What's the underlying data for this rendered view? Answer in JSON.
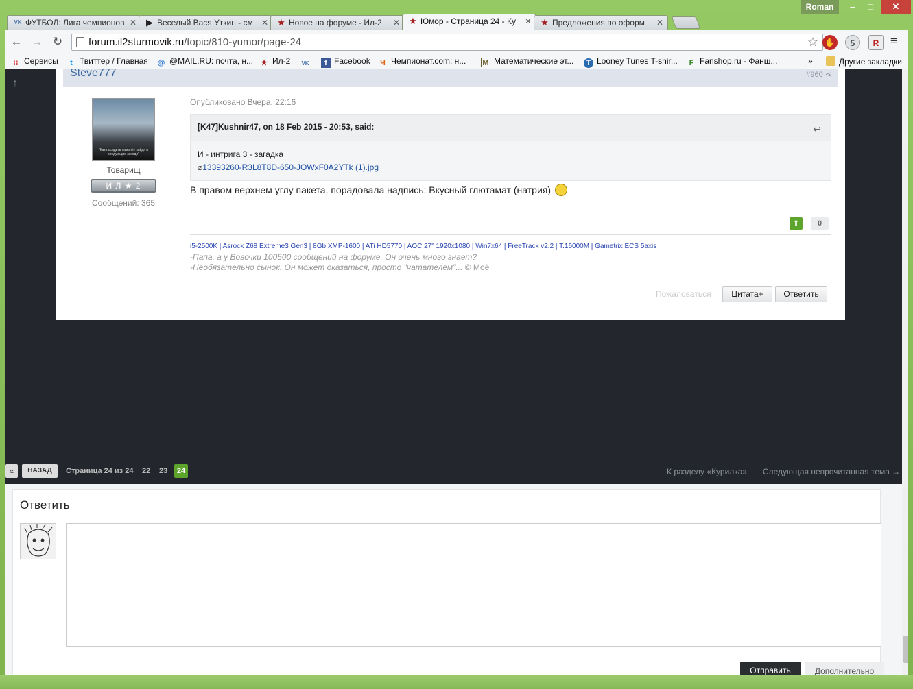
{
  "window": {
    "user": "Roman",
    "min": "–",
    "max": "□",
    "close": "✕"
  },
  "tabs": [
    {
      "title": "ФУТБОЛ: Лига чемпионов",
      "icon": "vk-icon",
      "glyph": "VK",
      "color": "#4a76a8"
    },
    {
      "title": "Веселый Вася Уткин - см",
      "icon": "play-icon",
      "glyph": "▶",
      "color": "#222222"
    },
    {
      "title": "Новое на форуме - Ил-2",
      "icon": "star-icon",
      "glyph": "★",
      "color": "#a31f1f"
    },
    {
      "title": "Юмор - Страница 24 - Ку",
      "icon": "star-icon",
      "glyph": "★",
      "color": "#a31f1f",
      "active": true
    },
    {
      "title": "Предложения по оформ",
      "icon": "star-icon",
      "glyph": "★",
      "color": "#a31f1f"
    }
  ],
  "toolbar": {
    "back": "←",
    "forward": "→",
    "reload": "↻",
    "url_domain": "forum.il2sturmovik.ru",
    "url_path": "/topic/810-yumor/page-24",
    "star": "☆",
    "menu": "≡",
    "ext_badge": "5"
  },
  "bookmarks": [
    {
      "label": "Сервисы",
      "icon": "apps-grid-icon",
      "glyph": "⁞⁞",
      "color": "#d44"
    },
    {
      "label": "Твиттер / Главная",
      "icon": "twitter-icon",
      "glyph": "t",
      "color": "#1da1f2"
    },
    {
      "label": "@MAIL.RU: почта, н...",
      "icon": "mailru-icon",
      "glyph": "@",
      "color": "#1d6fd1"
    },
    {
      "label": "Ил-2",
      "icon": "star-icon",
      "glyph": "★",
      "color": "#a31f1f"
    },
    {
      "label": "",
      "icon": "vk-icon",
      "glyph": "VK",
      "color": "#4a76a8"
    },
    {
      "label": "Facebook",
      "icon": "facebook-icon",
      "glyph": "f",
      "color": "#3b5998"
    },
    {
      "label": "Чемпионат.com: н...",
      "icon": "championat-icon",
      "glyph": "Ч",
      "color": "#e0661b"
    },
    {
      "label": "Математические эт...",
      "icon": "math-icon",
      "glyph": "M",
      "color": "#6b5b2a"
    },
    {
      "label": "Looney Tunes T-shir...",
      "icon": "tshirt-icon",
      "glyph": "T",
      "color": "#2a6bb0"
    },
    {
      "label": "Fanshop.ru - Фанш...",
      "icon": "fanshop-icon",
      "glyph": "F",
      "color": "#3a8a2a"
    }
  ],
  "bookmarks_more": "»",
  "bookmarks_other": "Другие закладки",
  "post": {
    "author": "Steve777",
    "number": "#960",
    "avatar_caption": "\"Как посадить самолёт зайдя в следующие заходе\"",
    "rank": "Товарищ",
    "rank_badge": "И Л ★ 2",
    "post_count": "Сообщений: 365",
    "posted": "Опубликовано Вчера, 22:16",
    "quote_header": "[K47]Kushnir47, on 18 Feb 2015 - 20:53, said:",
    "quote_text": "И - интрига 3 - загадка",
    "quote_link": "13393260-R3L8T8D-650-JOWxF0A2YTk (1).jpg",
    "text": "В правом верхнем углу пакета, порадовала надпись: Вкусный глютамат (натрия)",
    "rep_value": "0",
    "signature_specs": "i5-2500K | Asrock Z68 Extreme3 Gen3 | 8Gb XMP-1600 | ATi HD5770 | AOC 27\" 1920x1080 | Win7x64 | FreeTrack v2.2 | T.16000M | Gametrix ECS 5axis",
    "signature_line1": "-Папа, а у Вовочки 100500 сообщений на форуме. Он очень много знает?",
    "signature_line2": "-Необязательно сынок. Он может оказаться, просто \"чатателем\"...",
    "signature_author": "© Моё",
    "report": "Пожаловаться",
    "quote_button": "Цитата+",
    "reply_button": "Ответить"
  },
  "pagination": {
    "first": "«",
    "back": "НАЗАД",
    "info": "Страница 24 из 24",
    "pages": [
      "22",
      "23"
    ],
    "current": "24",
    "section_link": "К разделу «Курилка»",
    "sep": "·",
    "next_unread": "Следующая непрочитанная тема →"
  },
  "reply": {
    "title": "Ответить",
    "send": "Отправить",
    "more": "Дополнительно"
  }
}
